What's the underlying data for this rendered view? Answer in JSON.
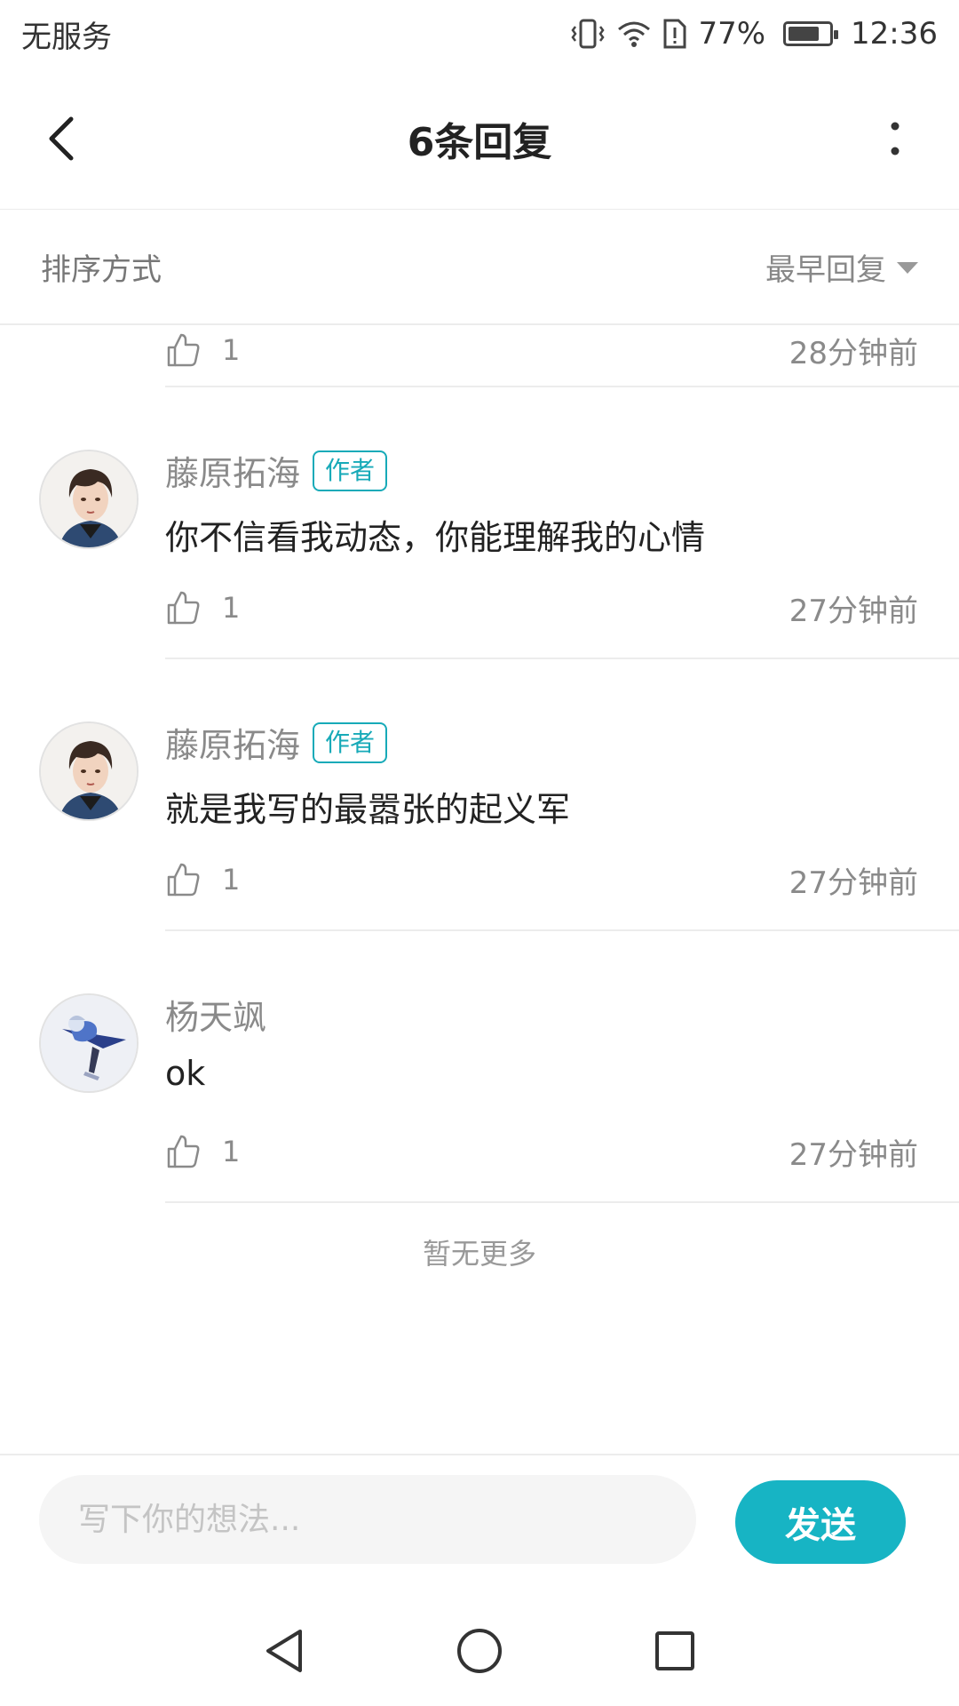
{
  "status_bar": {
    "carrier": "无服务",
    "battery": "77%",
    "battery_level": 0.77,
    "time": "12:36"
  },
  "header": {
    "title": "6条回复"
  },
  "sort": {
    "label": "排序方式",
    "selected": "最早回复"
  },
  "previous_reply": {
    "likes": "1",
    "time": "28分钟前"
  },
  "replies": [
    {
      "name": "藤原拓海",
      "badge": "作者",
      "text": "你不信看我动态，你能理解我的心情",
      "likes": "1",
      "time": "27分钟前"
    },
    {
      "name": "藤原拓海",
      "badge": "作者",
      "text": "就是我写的最嚣张的起义军",
      "likes": "1",
      "time": "27分钟前"
    },
    {
      "name": "杨天飒",
      "text": "ok",
      "likes": "1",
      "time": "27分钟前"
    }
  ],
  "no_more": "暂无更多",
  "composer": {
    "placeholder": "写下你的想法...",
    "send_label": "发送"
  },
  "colors": {
    "accent": "#17b4c4",
    "badge": "#17aab8"
  }
}
